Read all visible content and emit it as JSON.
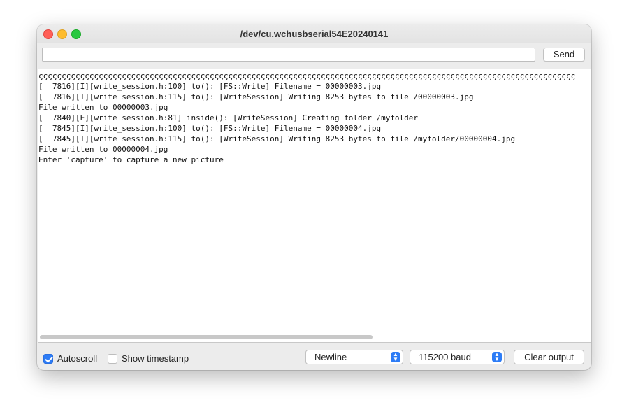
{
  "window": {
    "title": "/dev/cu.wchusbserial54E20240141"
  },
  "send_bar": {
    "input_value": "",
    "send_label": "Send"
  },
  "output": {
    "lines": [
      "ςςςςςςςςςςςςςςςςςςςςςςςςςςςςςςςςςςςςςςςςςςςςςςςςςςςςςςςςςςςςςςςςςςςςςςςςςςςςςςςςςςςςςςςςςςςςςςςςςςςςςςςςςςςςςςςςςςςς",
      "[  7816][I][write_session.h:100] to(): [FS::Write] Filename = 00000003.jpg",
      "[  7816][I][write_session.h:115] to(): [WriteSession] Writing 8253 bytes to file /00000003.jpg",
      "File written to 00000003.jpg",
      "[  7840][E][write_session.h:81] inside(): [WriteSession] Creating folder /myfolder",
      "[  7845][I][write_session.h:100] to(): [FS::Write] Filename = 00000004.jpg",
      "[  7845][I][write_session.h:115] to(): [WriteSession] Writing 8253 bytes to file /myfolder/00000004.jpg",
      "File written to 00000004.jpg",
      "Enter 'capture' to capture a new picture"
    ]
  },
  "bottom_bar": {
    "autoscroll": {
      "label": "Autoscroll",
      "checked": true
    },
    "show_timestamp": {
      "label": "Show timestamp",
      "checked": false
    },
    "line_ending": {
      "selected": "Newline"
    },
    "baud_rate": {
      "selected": "115200 baud"
    },
    "clear_label": "Clear output"
  },
  "colors": {
    "accent": "#2d7cf6",
    "close": "#ff5f57",
    "minimize": "#febc2e",
    "zoom": "#28c840"
  }
}
